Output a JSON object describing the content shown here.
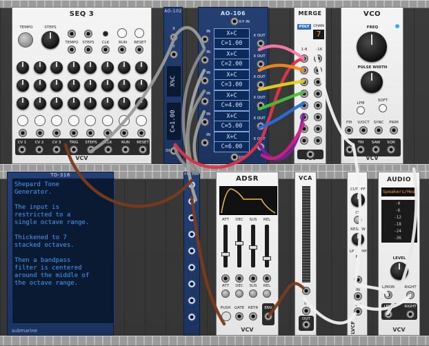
{
  "seq3": {
    "title": "SEQ 3",
    "tempo_label": "TEMPO",
    "steps_label": "STEPS",
    "small_labels": [
      "TEMPO",
      "STEPS",
      "CLK",
      "RUN",
      "RESET"
    ],
    "jacks": [
      "CV 1",
      "CV 2",
      "CV 3",
      "TRIG",
      "STEPS",
      "CLK",
      "RUN",
      "RESET"
    ],
    "brand": "VCV"
  },
  "ao_small": {
    "title": "AO-102",
    "x_label": "X",
    "y_label": "Y",
    "in_label": "IN",
    "out_label": "OUT",
    "func1": "X%C",
    "func2": "C=1.00"
  },
  "ao106": {
    "title": "AO-106",
    "top": "X-Y IN",
    "bottom": "OUT",
    "rows": [
      {
        "f": "X+C",
        "c": "C=1.00"
      },
      {
        "f": "X+C",
        "c": "C=2.00"
      },
      {
        "f": "X+C",
        "c": "C=3.00"
      },
      {
        "f": "X+C",
        "c": "C=4.00"
      },
      {
        "f": "X+C",
        "c": "C=5.00"
      },
      {
        "f": "X+C",
        "c": "C=6.00"
      }
    ],
    "left_labels": [
      "IN",
      "IN",
      "IN",
      "IN",
      "IN",
      "IN"
    ],
    "right_labels": [
      "X OUT",
      "X OUT",
      "X OUT",
      "X OUT",
      "X OUT",
      "X OUT"
    ]
  },
  "merge": {
    "title": "MERGE",
    "poly": "POLY",
    "chan_label": "CHAN",
    "chan_value": "7",
    "col1": "1-8",
    "col2": "9-16",
    "brand": "VCV",
    "mono": "MONO IN"
  },
  "vco": {
    "title": "VCO",
    "freq": "FREQ",
    "pw": "PULSE WIDTH",
    "lfm": "LFM",
    "soft": "SOFT",
    "jacks_top": [
      "FM",
      "V/OCT",
      "SYNC",
      "PWM"
    ],
    "jacks_bot": [
      "TRI",
      "SAW",
      "SQR"
    ],
    "brand": "VCV"
  },
  "td316": {
    "title": "TD-316",
    "text": "Shepard Tone\nGenerator.\n\nThe input is\nrestricted to a\nsingle octave range.\n\nThickened to 7\nstacked octaves.\n\nThen a bandpass\nfilter is centered\naround the middle of\nthe octave range.",
    "footer": "submarine"
  },
  "mult": {
    "title": "PO-316"
  },
  "adsr": {
    "title": "ADSR",
    "sliders": [
      "ATT",
      "DEC",
      "SUS",
      "REL"
    ],
    "knobs": [
      "ATT",
      "DEC",
      "SUS",
      "REL"
    ],
    "jacks": [
      "PUSH",
      "GATE",
      "RETR",
      "ENV"
    ],
    "brand": "VCV"
  },
  "vca": {
    "title": "VCA",
    "in": "IN",
    "out": "OUT",
    "brand": "VCV"
  },
  "vcf": {
    "title": "VCF",
    "cutoff": "CUTOFF",
    "cv": "CV",
    "res": "RES/BW",
    "lp": "LP",
    "hp": "HP",
    "bp": "BP",
    "in": "IN",
    "cv2": "CV",
    "label": "LVCF"
  },
  "audio": {
    "title": "AUDIO",
    "device": "Speakers/Hea",
    "meter": [
      "-0",
      "-6",
      "-12",
      "-18",
      "-24",
      "-36"
    ],
    "level": "LEVEL",
    "l": "L/MON",
    "r": "RIGHT",
    "l2": "LEFT",
    "r2": "RIGHT",
    "brand": "VCV"
  },
  "colors": {
    "cable_orange": "#f28a1f",
    "cable_gray": "#9a9a9a",
    "cable_brown": "#7a3b1b",
    "cable_red": "#e0344a",
    "cable_purple": "#7a1fa0",
    "cable_blue": "#2a6de0",
    "cable_green": "#4bbf3a",
    "cable_yellow": "#e8d01a",
    "cable_pink": "#ff7aa8",
    "cable_white": "#f2f2f2",
    "cable_magenta": "#d02080"
  }
}
